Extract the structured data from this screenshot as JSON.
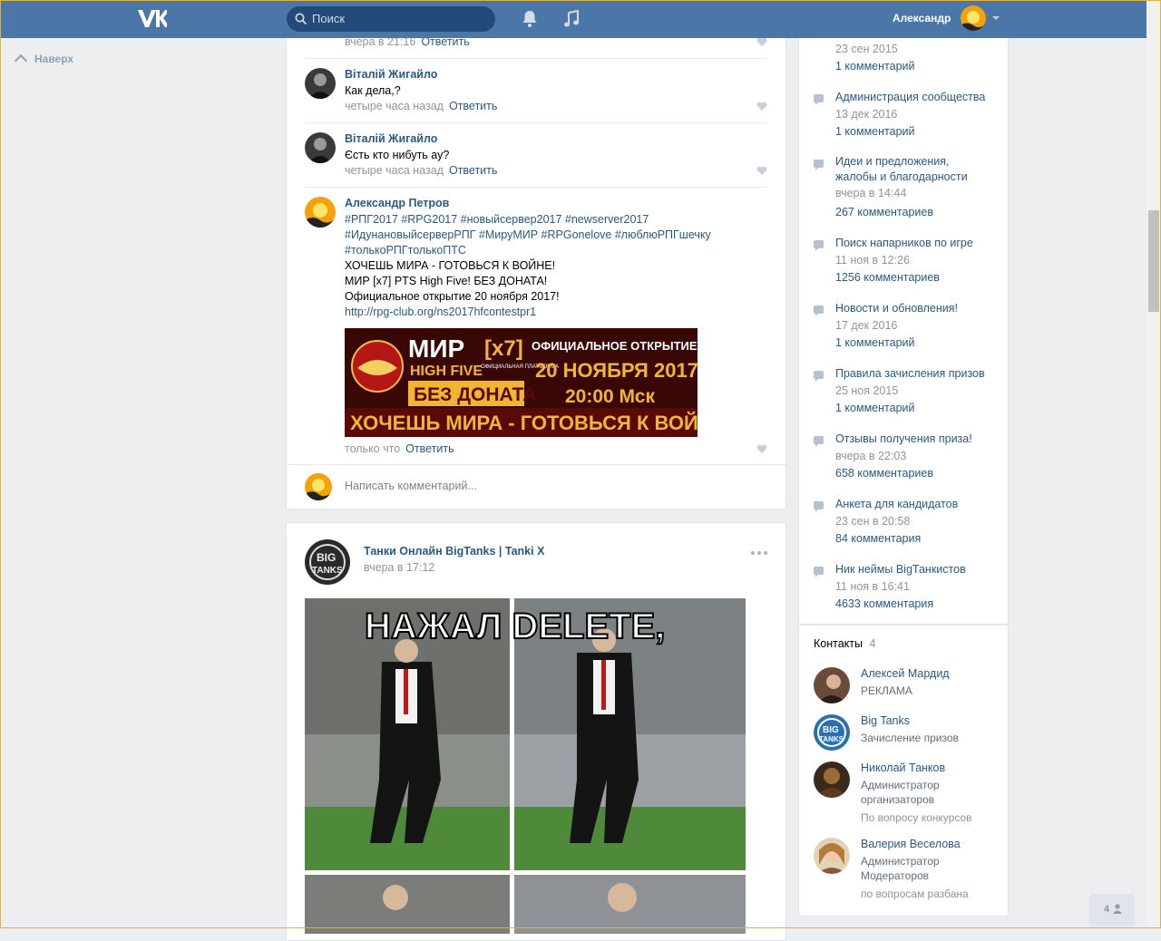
{
  "header": {
    "search_placeholder": "Поиск",
    "user_name": "Александр"
  },
  "sidebar_left": {
    "back_to_top": "Наверх"
  },
  "comments": [
    {
      "meta_time": "вчера в 21:16",
      "reply": "Ответить"
    },
    {
      "author": "Віталій Жигайло",
      "text": "Как дела,?",
      "time": "четыре часа назад",
      "reply": "Ответить"
    },
    {
      "author": "Віталій Жигайло",
      "text": "Єсть кто нибуть ау?",
      "time": "четыре часа назад",
      "reply": "Ответить"
    },
    {
      "author": "Александр Петров",
      "tags_line1": "#РПГ2017 #RPG2017 #новыйсервер2017 #newserver2017",
      "tags_line2": "#ИдунановыйсерверРПГ #МируМИР #RPGonelove #люблюРПГшечку",
      "tags_line3": "#толькоРПГтолькоПТС",
      "line4": "ХОЧЕШЬ МИРА - ГОТОВЬСЯ К ВОЙНЕ!",
      "line5": "МИР [x7] PTS High Five! БЕЗ ДОНАТА!",
      "line6": "Официальное открытие 20 ноября 2017!",
      "link": "http://rpg-club.org/ns2017hfcontestpr1",
      "time": "только что",
      "reply": "Ответить"
    }
  ],
  "banner": {
    "mir": "МИР",
    "x7": "[x7]",
    "high_five": "HIGH FIVE",
    "platform": "ОФИЦИАЛЬНАЯ ПЛАТФОРМА",
    "no_donate": "БЕЗ ДОНАТА",
    "official_open": "ОФИЦИАЛЬНОЕ ОТКРЫТИЕ",
    "date": "20 НОЯБРЯ 2017",
    "time": "20:00 Мск",
    "slogan": "ХОЧЕШЬ МИРА - ГОТОВЬСЯ К ВОЙНЕ"
  },
  "comment_input": {
    "placeholder": "Написать комментарий..."
  },
  "post": {
    "author": "Танки Онлайн BigTanks | Tanki X",
    "time": "вчера в 17:12",
    "logo_text1": "BIG",
    "logo_text2": "TANKS",
    "meme_caption": "НАЖАЛ DELETE,"
  },
  "discussions": [
    {
      "date": "23 сен 2015",
      "count": "1 комментарий"
    },
    {
      "title": "Администрация сообщества",
      "date": "13 дек 2016",
      "count": "1 комментарий"
    },
    {
      "title": "Идеи и предложения,",
      "title2": "жалобы и благодарности",
      "date": "вчера в 14:44",
      "count": "267 комментариев"
    },
    {
      "title": "Поиск напарников по игре",
      "date": "11 ноя в 12:26",
      "count": "1256 комментариев"
    },
    {
      "title": "Новости и обновления!",
      "date": "17 дек 2016",
      "count": "1 комментарий"
    },
    {
      "title": "Правила зачисления призов",
      "date": "25 ноя 2015",
      "count": "1 комментарий"
    },
    {
      "title": "Отзывы получения приза!",
      "date": "вчера в 22:03",
      "count": "658 комментариев"
    },
    {
      "title": "Анкета для кандидатов",
      "date": "23 сен в 20:58",
      "count": "84 комментария"
    },
    {
      "title": "Ник неймы BigТанкистов",
      "date": "11 ноя в 16:41",
      "count": "4633 комментария"
    }
  ],
  "contacts": {
    "title": "Контакты",
    "count": "4",
    "items": [
      {
        "name": "Алексей Мардид",
        "role": "РЕКЛАМА"
      },
      {
        "name": "Big Tanks",
        "role": "Зачисление призов",
        "logo1": "BIG",
        "logo2": "TANKS"
      },
      {
        "name": "Николай Танков",
        "role": "Администратор\nорганизаторов",
        "role2": "По вопросу конкурсов"
      },
      {
        "name": "Валерия Веселова",
        "role": "Администратор\nМодераторов",
        "role2": "по вопросам разбана"
      }
    ]
  },
  "footer": {
    "count": "4"
  },
  "colors": {
    "header": "#4a76a8",
    "link": "#2a5885",
    "meta": "#939393",
    "page_bg": "#edeef0"
  }
}
